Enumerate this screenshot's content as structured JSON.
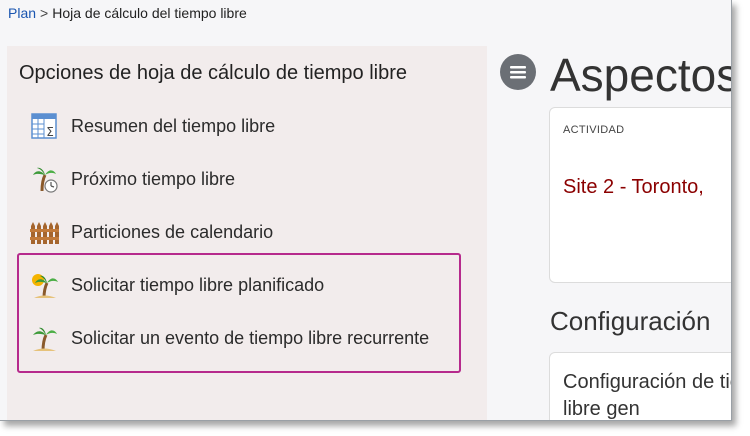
{
  "breadcrumb": {
    "root": "Plan",
    "separator": ">",
    "current": "Hoja de cálculo del tiempo libre"
  },
  "sidebar": {
    "title": "Opciones de hoja de cálculo de tiempo libre",
    "items": [
      {
        "label": "Resumen del tiempo libre",
        "icon": "spreadsheet-sum-icon"
      },
      {
        "label": "Próximo tiempo libre",
        "icon": "palm-tree-clock-icon"
      },
      {
        "label": "Particiones de calendario",
        "icon": "fence-icon"
      },
      {
        "label": "Solicitar tiempo libre planificado",
        "icon": "palm-tree-sun-icon"
      },
      {
        "label": "Solicitar un evento de tiempo libre recurrente",
        "icon": "palm-tree-icon"
      }
    ],
    "highlight_color": "#b62a8c"
  },
  "main": {
    "heading": "Aspectos",
    "activity_card": {
      "label": "ACTIVIDAD",
      "value": "Site 2 - Toronto,"
    },
    "section_heading": "Configuración",
    "config_card_text": "Configuración de tiempo libre gen"
  },
  "colors": {
    "link": "#1a55b0",
    "sidebar_bg": "#f2ecec",
    "activity_value": "#8b0000"
  }
}
